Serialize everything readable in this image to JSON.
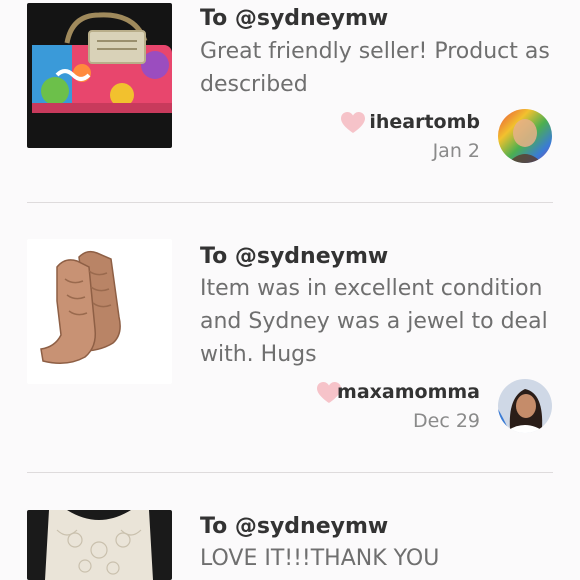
{
  "reviews": [
    {
      "to": "To @sydneymw",
      "text": "Great friendly seller! Product as described",
      "username": "iheartomb",
      "date": "Jan 2"
    },
    {
      "to": "To @sydneymw",
      "text": "Item was in excellent condition and Sydney was a jewel to deal with. Hugs",
      "username": "maxamomma",
      "date": "Dec 29"
    },
    {
      "to": "To @sydneymw",
      "text": "LOVE IT!!!THANK YOU"
    }
  ],
  "colors": {
    "heart": "#f6c3c9",
    "divider": "#dedbdc",
    "background": "#fbfafb"
  }
}
